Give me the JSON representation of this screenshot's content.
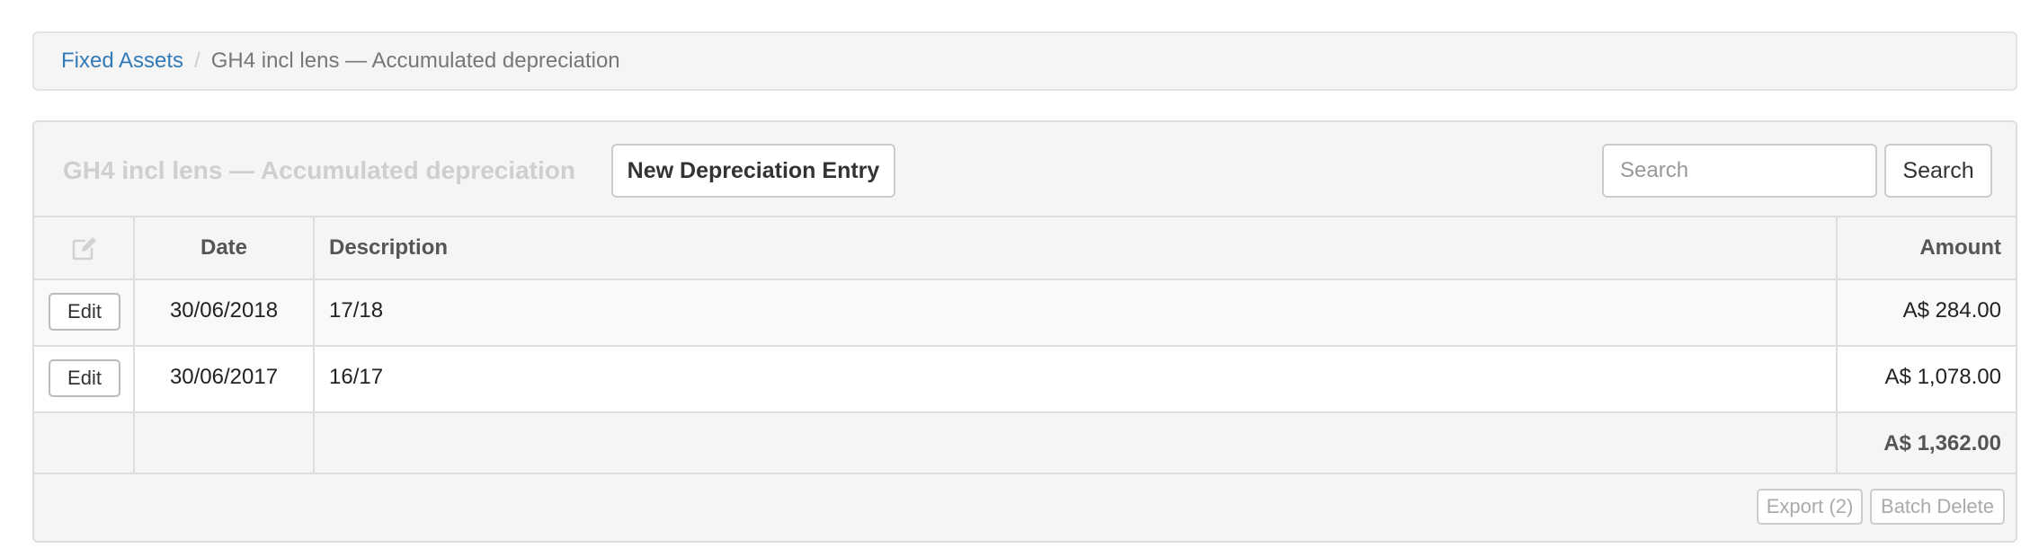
{
  "breadcrumb": {
    "root_label": "Fixed Assets",
    "separator": "/",
    "current_label": "GH4 incl lens — Accumulated depreciation"
  },
  "panel": {
    "title": "GH4 incl lens — Accumulated depreciation",
    "new_button_label": "New Depreciation Entry",
    "search": {
      "placeholder": "Search",
      "value": "",
      "button_label": "Search"
    }
  },
  "table": {
    "columns": {
      "edit_icon": "edit-icon",
      "date": "Date",
      "description": "Description",
      "amount": "Amount"
    },
    "rows": [
      {
        "edit_label": "Edit",
        "date": "30/06/2018",
        "description": "17/18",
        "amount": "A$ 284.00"
      },
      {
        "edit_label": "Edit",
        "date": "30/06/2017",
        "description": "16/17",
        "amount": "A$ 1,078.00"
      }
    ],
    "total": "A$ 1,362.00"
  },
  "footer": {
    "export_label": "Export (2)",
    "batch_delete_label": "Batch Delete"
  },
  "colors": {
    "link": "#337ab7",
    "panel_background": "#f5f5f5",
    "border": "#dddddd",
    "title_muted": "#cfcfcf"
  }
}
